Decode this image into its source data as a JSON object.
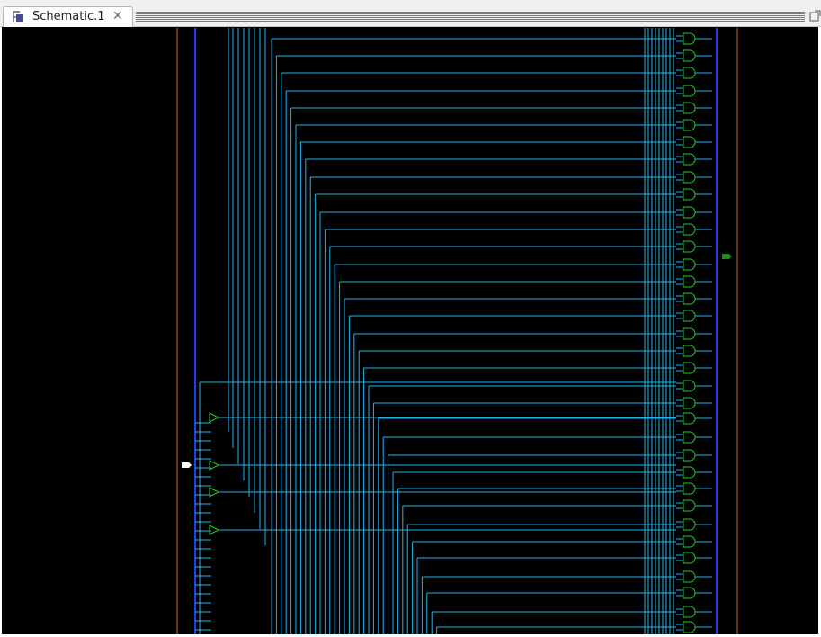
{
  "tab": {
    "icon": "schematic-document-icon",
    "title": "Schematic.1",
    "close_glyph": "✕"
  },
  "window": {
    "maximize_icon": "maximize-view-icon"
  },
  "canvas": {
    "background": "#000000",
    "colors": {
      "wire": "#22b4ee",
      "bus": "#1a3cff",
      "boundary": "#d2692d",
      "gate": "#28c828",
      "input_port": "#ffffff",
      "output_port": "#1a8a1a"
    }
  }
}
